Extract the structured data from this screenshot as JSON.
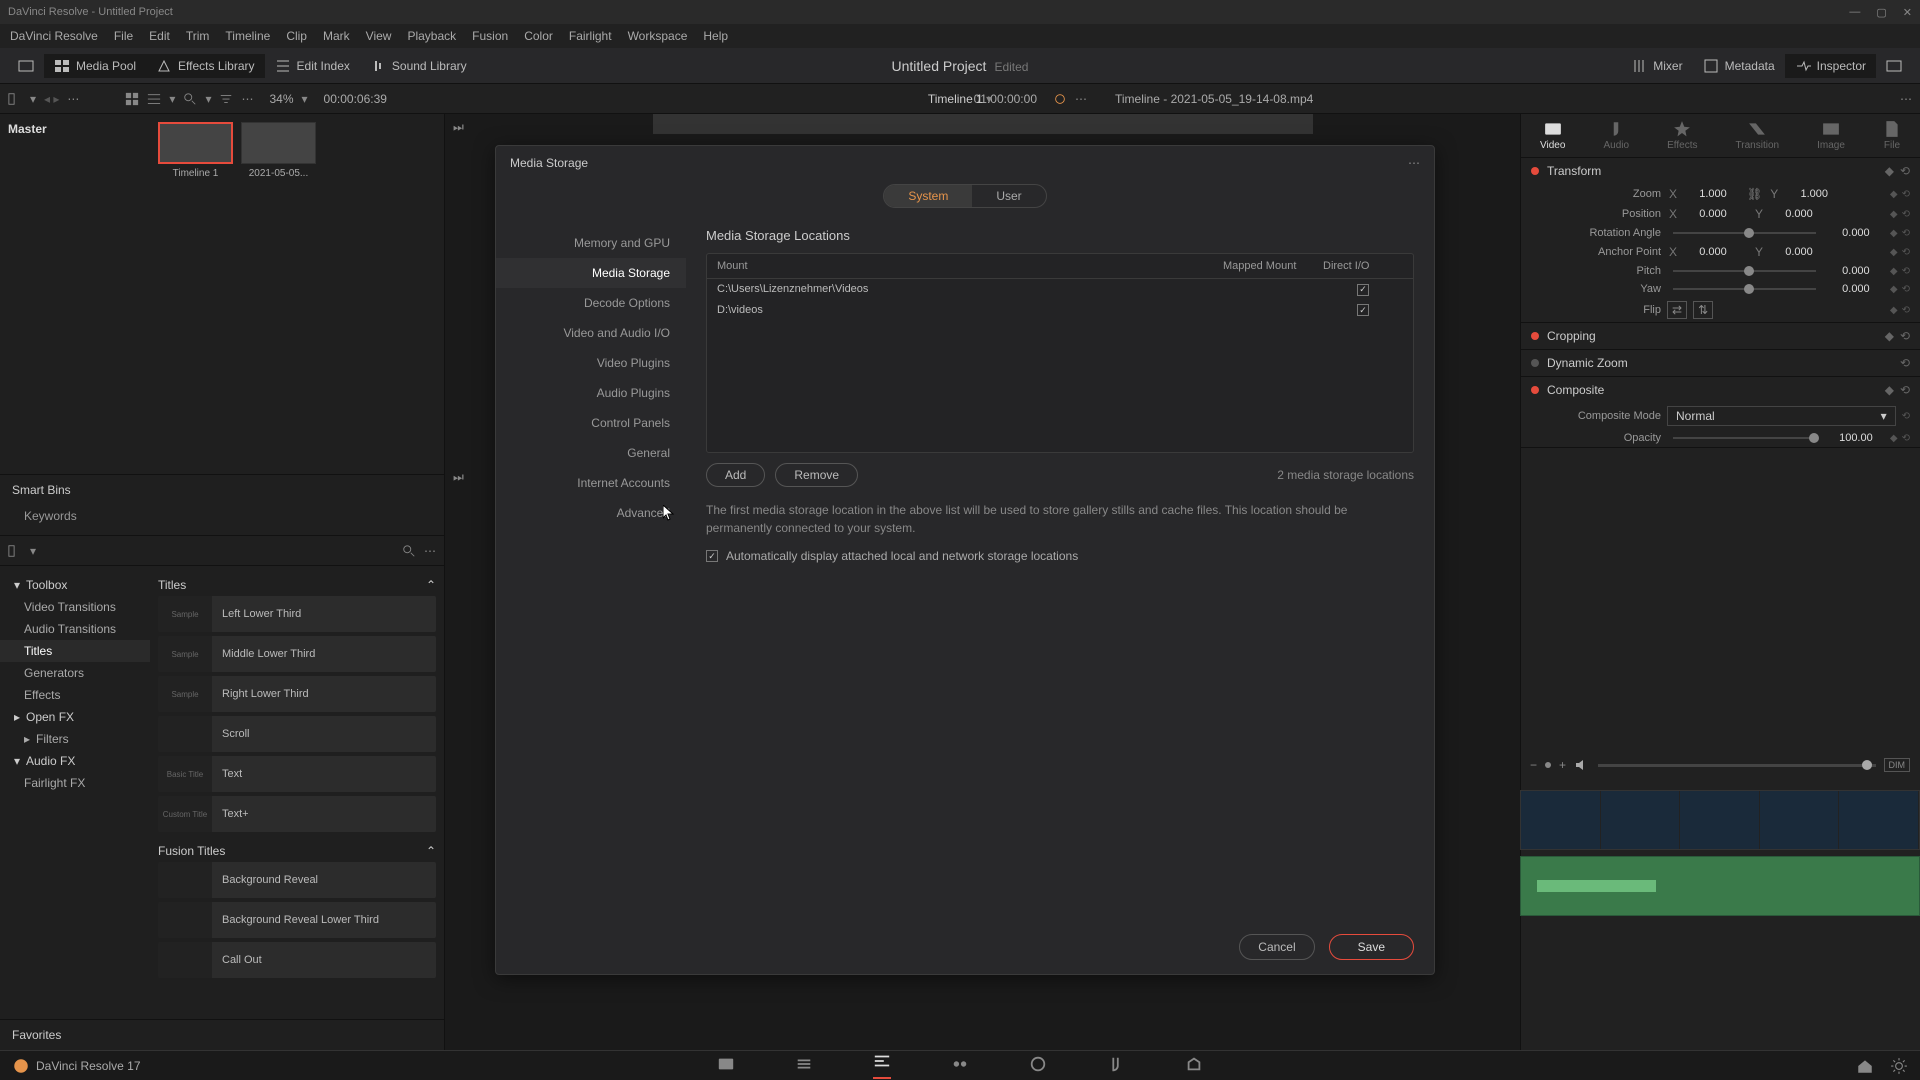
{
  "window": {
    "title": "DaVinci Resolve - Untitled Project"
  },
  "menubar": [
    "DaVinci Resolve",
    "File",
    "Edit",
    "Trim",
    "Timeline",
    "Clip",
    "Mark",
    "View",
    "Playback",
    "Fusion",
    "Color",
    "Fairlight",
    "Workspace",
    "Help"
  ],
  "toolbar": {
    "media_pool": "Media Pool",
    "effects_library": "Effects Library",
    "edit_index": "Edit Index",
    "sound_library": "Sound Library",
    "mixer": "Mixer",
    "metadata": "Metadata",
    "inspector": "Inspector",
    "project_title": "Untitled Project",
    "edited": "Edited"
  },
  "subtoolbar": {
    "zoom": "34%",
    "timecode_left": "00:00:06:39",
    "timeline_name": "Timeline 1",
    "timecode_right": "01:00:00:00",
    "clip_name": "Timeline - 2021-05-05_19-14-08.mp4"
  },
  "media_pool": {
    "master": "Master",
    "clips": [
      {
        "name": "Timeline 1",
        "selected": true
      },
      {
        "name": "2021-05-05...",
        "selected": false
      }
    ],
    "smart_bins": "Smart Bins",
    "keywords": "Keywords"
  },
  "fx": {
    "tree": {
      "toolbox": "Toolbox",
      "video_transitions": "Video Transitions",
      "audio_transitions": "Audio Transitions",
      "titles": "Titles",
      "generators": "Generators",
      "effects": "Effects",
      "open_fx": "Open FX",
      "filters": "Filters",
      "audio_fx": "Audio FX",
      "fairlight_fx": "Fairlight FX"
    },
    "titles_hdr": "Titles",
    "titles": [
      "Left Lower Third",
      "Middle Lower Third",
      "Right Lower Third",
      "Scroll",
      "Text",
      "Text+"
    ],
    "title_swatches": [
      "Sample",
      "Sample",
      "Sample",
      "",
      "Basic Title",
      "Custom Title"
    ],
    "fusion_hdr": "Fusion Titles",
    "fusion": [
      "Background Reveal",
      "Background Reveal Lower Third",
      "Call Out"
    ],
    "favorites": "Favorites"
  },
  "inspector": {
    "tabs": [
      "Video",
      "Audio",
      "Effects",
      "Transition",
      "Image",
      "File"
    ],
    "transform": {
      "hdr": "Transform",
      "zoom": "Zoom",
      "zoom_x": "1.000",
      "zoom_y": "1.000",
      "position": "Position",
      "pos_x": "0.000",
      "pos_y": "0.000",
      "rotation": "Rotation Angle",
      "rotation_val": "0.000",
      "anchor": "Anchor Point",
      "anchor_x": "0.000",
      "anchor_y": "0.000",
      "pitch": "Pitch",
      "pitch_val": "0.000",
      "yaw": "Yaw",
      "yaw_val": "0.000",
      "flip": "Flip"
    },
    "cropping": "Cropping",
    "dynamic_zoom": "Dynamic Zoom",
    "composite": {
      "hdr": "Composite",
      "mode_lbl": "Composite Mode",
      "mode_val": "Normal",
      "opacity_lbl": "Opacity",
      "opacity_val": "100.00"
    }
  },
  "volume": {
    "dim": "DIM"
  },
  "modal": {
    "title": "Media Storage",
    "seg_system": "System",
    "seg_user": "User",
    "sidebar": [
      "Memory and GPU",
      "Media Storage",
      "Decode Options",
      "Video and Audio I/O",
      "Video Plugins",
      "Audio Plugins",
      "Control Panels",
      "General",
      "Internet Accounts",
      "Advanced"
    ],
    "section_title": "Media Storage Locations",
    "columns": {
      "mount": "Mount",
      "mapped": "Mapped Mount",
      "direct": "Direct I/O"
    },
    "rows": [
      {
        "mount": "C:\\Users\\Lizenznehmer\\Videos",
        "direct": true
      },
      {
        "mount": "D:\\videos",
        "direct": true
      }
    ],
    "add": "Add",
    "remove": "Remove",
    "count": "2 media storage locations",
    "desc": "The first media storage location in the above list will be used to store gallery stills and cache files. This location should be permanently connected to your system.",
    "auto": "Automatically display attached local and network storage locations",
    "cancel": "Cancel",
    "save": "Save"
  },
  "footer": {
    "version": "DaVinci Resolve 17"
  }
}
